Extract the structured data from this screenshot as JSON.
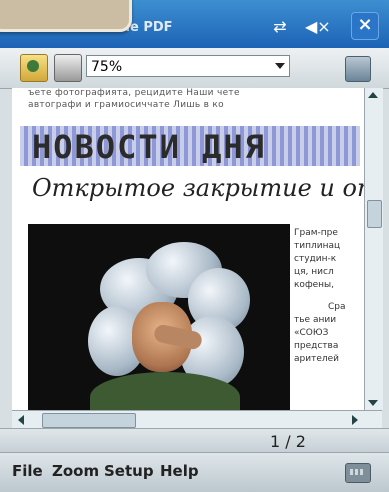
{
  "app": {
    "title": "Great Fine PDF"
  },
  "toolbar": {
    "zoom_value": "75%"
  },
  "document": {
    "text_lines": [
      "ъете фотографията, рецидите   Наши чете",
      "автографи   и   грамиосиччате   Лишь в ко"
    ],
    "headline": "НОВОСТИ ДНЯ",
    "subheadline": "Открытое закрытие и от",
    "column_lines": [
      "Грам-пре",
      "типлинац",
      "студин-к",
      "ця, нисл",
      "кофены,",
      "Сра",
      "тье ании",
      "«СОЮЗ",
      "предства",
      "арителей"
    ]
  },
  "status": {
    "page": "1 / 2"
  },
  "menu": {
    "items": [
      "File",
      "Zoom",
      "Setup",
      "Help"
    ]
  }
}
